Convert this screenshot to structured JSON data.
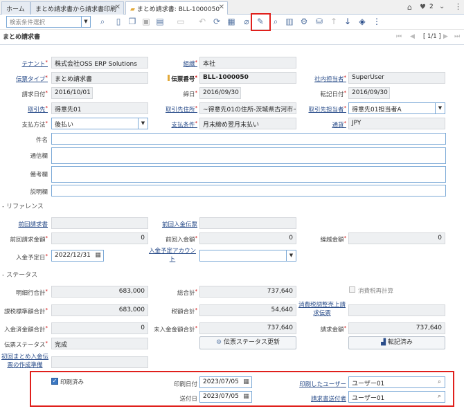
{
  "tabs": {
    "home": "ホーム",
    "print": "まとめ請求書から請求書印刷",
    "active": "まとめ請求書: BLL-1000050",
    "close": "✕"
  },
  "topright": {
    "notify_count": "2"
  },
  "toolbar": {
    "search_placeholder": "検索条件選択"
  },
  "window": {
    "title": "まとめ請求書",
    "pager": "[ 1/1 ]"
  },
  "form": {
    "tenant_label": "テナント",
    "tenant": "株式会社OSS ERP Solutions",
    "org_label": "組織",
    "org": "本社",
    "doctype_label": "伝票タイプ",
    "doctype": "まとめ請求書",
    "docno_label": "伝票番号",
    "docno": "BLL-1000050",
    "salesrep_label": "社内担当者",
    "salesrep": "SuperUser",
    "invdate_label": "請求日付",
    "invdate": "2016/10/01",
    "cutoff_label": "締日",
    "cutoff": "2016/09/30",
    "acctdate_label": "転記日付",
    "acctdate": "2016/09/30",
    "bp_label": "取引先",
    "bp": "得意先01",
    "bploc_label": "取引先住所",
    "bploc": "~得意先01の住所-茨城県古河市~",
    "bpcontact_label": "取引先担当者",
    "bpcontact": "得意先01担当者A",
    "payrule_label": "支払方法",
    "payrule": "後払い",
    "payterm_label": "支払条件",
    "payterm": "月末締め翌月末払い",
    "currency_label": "通貨",
    "currency": "JPY",
    "subject_label": "件名",
    "comm_label": "通信欄",
    "remark_label": "備考欄",
    "desc_label": "説明欄"
  },
  "ref": {
    "section": "- リファレンス",
    "previnv_label": "前回請求書",
    "prevpay_label": "前回入金伝票",
    "previnvamt_label": "前回請求金額",
    "previnvamt": "0",
    "prevpayamt_label": "前回入金額",
    "prevpayamt": "0",
    "carry_label": "繰越金額",
    "carry": "0",
    "duedate_label": "入金予定日",
    "duedate": "2022/12/31",
    "payacct_label": "入金予定アカウント"
  },
  "status": {
    "section": "- ステータス",
    "lines_label": "明細行合計",
    "lines": "683,000",
    "total_label": "総合計",
    "total": "737,640",
    "recalc_label": "消費税再計算",
    "taxbase_label": "課税標準額合計",
    "taxbase": "683,000",
    "tax_label": "税額合計",
    "tax": "54,640",
    "taxadj_label": "消費税調整売上請求伝票",
    "paid_label": "入金済金額合計",
    "paid": "0",
    "open_label": "未入金金額合計",
    "open": "737,640",
    "invamt_label": "請求金額",
    "invamt": "737,640",
    "docstatus_label": "伝票ステータス",
    "docstatus": "完成",
    "update_btn": "伝票ステータス更新",
    "posted_btn": "転記済み",
    "initpay_label": "初回まとめ入金伝票の作成準備",
    "printed_label": "印刷済み",
    "printdate_label": "印刷日付",
    "printdate": "2023/07/05",
    "printuser_label": "印刷したユーザー",
    "printuser": "ユーザー01",
    "senddate_label": "送付日",
    "senddate": "2023/07/05",
    "senduser_label": "請求書送付者",
    "senduser": "ユーザー01"
  },
  "colors": {
    "highlight": "#e0201c",
    "accent": "#2a4d8a"
  }
}
